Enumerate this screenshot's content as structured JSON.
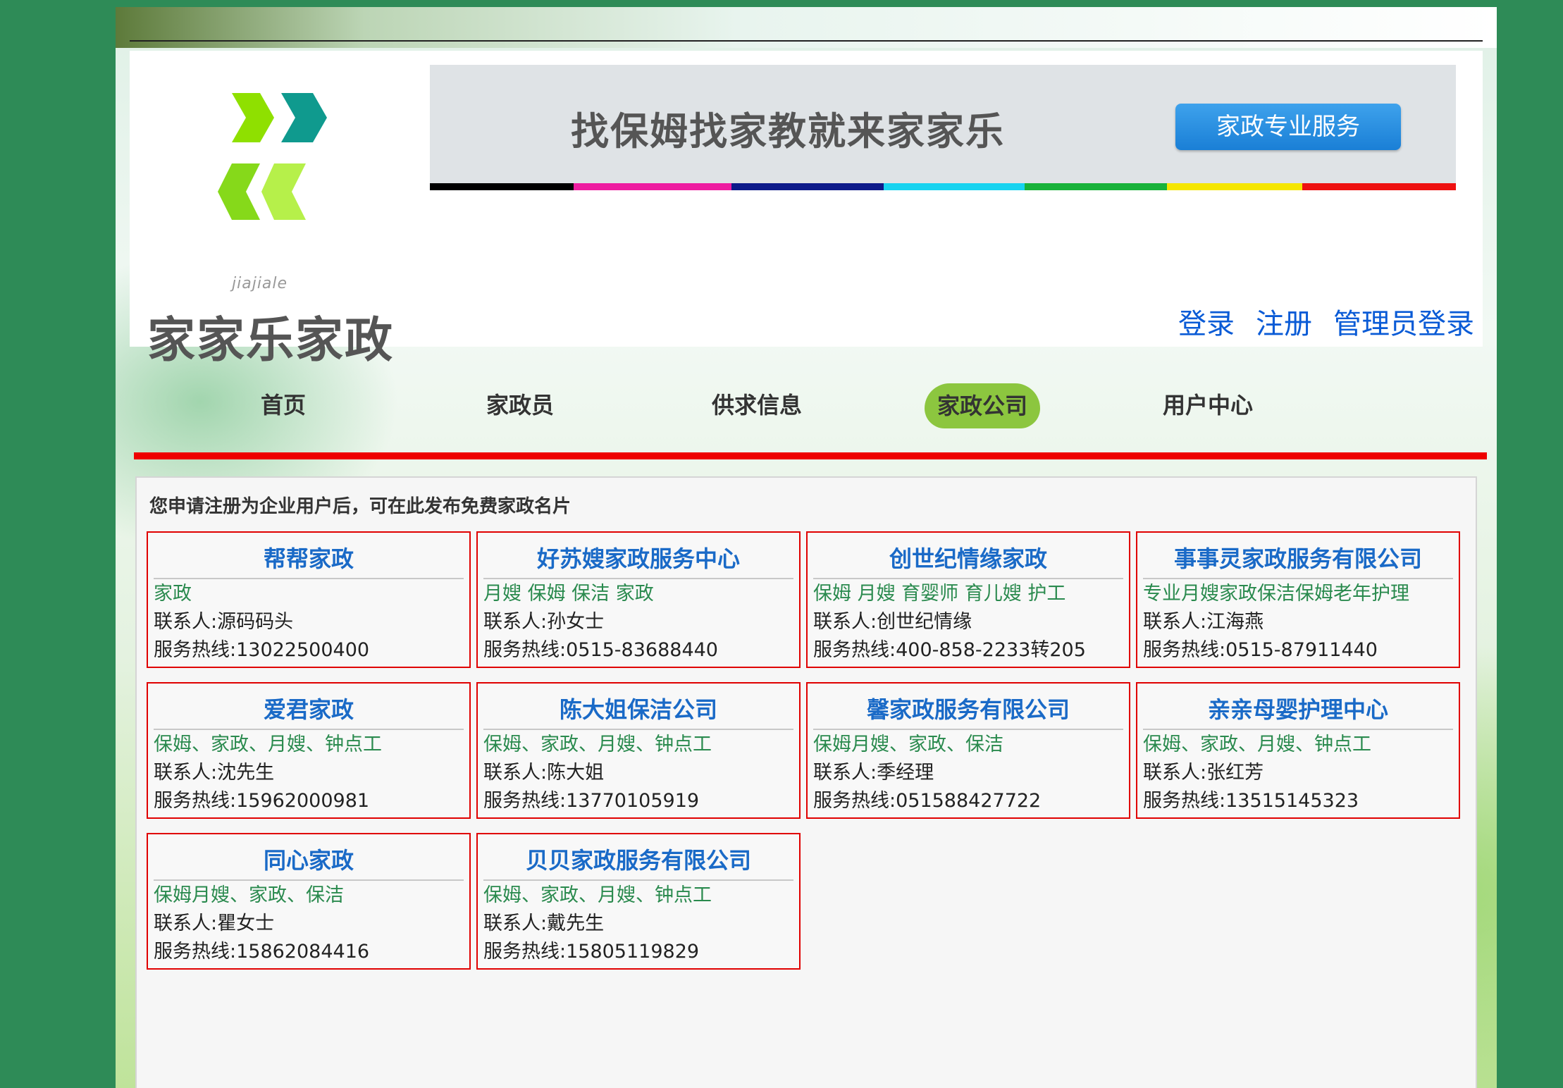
{
  "header": {
    "logo_sub": "jiajiale",
    "logo_name": "家家乐家政",
    "banner_slogan": "找保姆找家教就来家家乐",
    "banner_button": "家政专业服务",
    "colorbar": [
      "#000000",
      "#ee1ca0",
      "#0d1a8a",
      "#17d3f0",
      "#18b23a",
      "#f5e600",
      "#ee1111"
    ]
  },
  "auth": {
    "login": "登录",
    "register": "注册",
    "admin_login": "管理员登录"
  },
  "nav": {
    "items": [
      "首页",
      "家政员",
      "供求信息",
      "家政公司",
      "用户中心"
    ],
    "active": "家政公司"
  },
  "content": {
    "notice": "您申请注册为企业用户后，可在此发布免费家政名片",
    "cards": [
      {
        "name": "帮帮家政",
        "services": "家政",
        "contact": "联系人:源码码头",
        "phone": "服务热线:13022500400"
      },
      {
        "name": "好苏嫂家政服务中心",
        "services": "月嫂 保姆 保洁 家政",
        "contact": "联系人:孙女士",
        "phone": "服务热线:0515-83688440"
      },
      {
        "name": "创世纪情缘家政",
        "services": "保姆 月嫂 育婴师 育儿嫂 护工",
        "contact": "联系人:创世纪情缘",
        "phone": "服务热线:400-858-2233转205"
      },
      {
        "name": "事事灵家政服务有限公司",
        "services": "专业月嫂家政保洁保姆老年护理",
        "contact": "联系人:江海燕",
        "phone": "服务热线:0515-87911440"
      },
      {
        "name": "爱君家政",
        "services": "保姆、家政、月嫂、钟点工",
        "contact": "联系人:沈先生",
        "phone": "服务热线:15962000981"
      },
      {
        "name": "陈大姐保洁公司",
        "services": "保姆、家政、月嫂、钟点工",
        "contact": "联系人:陈大姐",
        "phone": "服务热线:13770105919"
      },
      {
        "name": "馨家政服务有限公司",
        "services": "保姆月嫂、家政、保洁",
        "contact": "联系人:季经理",
        "phone": "服务热线:051588427722"
      },
      {
        "name": "亲亲母婴护理中心",
        "services": "保姆、家政、月嫂、钟点工",
        "contact": "联系人:张红芳",
        "phone": "服务热线:13515145323"
      },
      {
        "name": "同心家政",
        "services": "保姆月嫂、家政、保洁",
        "contact": "联系人:瞿女士",
        "phone": "服务热线:15862084416"
      },
      {
        "name": "贝贝家政服务有限公司",
        "services": "保姆、家政、月嫂、钟点工",
        "contact": "联系人:戴先生",
        "phone": "服务热线:15805119829"
      }
    ]
  },
  "colors": {
    "background": "#2e8b57",
    "accent_red": "#ee0000",
    "link_blue": "#0a5bd6",
    "nav_active": "#8cc63f"
  }
}
